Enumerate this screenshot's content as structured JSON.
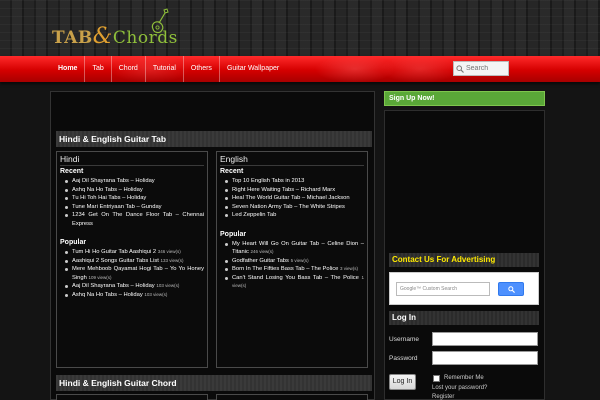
{
  "header": {
    "logo_tab": "TAB",
    "logo_amp": "&",
    "logo_chords": "Chords"
  },
  "nav": {
    "items": [
      "Home",
      "Tab",
      "Chord",
      "Tutorial",
      "Others",
      "Guitar Wallpaper"
    ],
    "search_placeholder": "Search"
  },
  "main": {
    "section1_title": "Hindi & English Guitar Tab",
    "section2_title": "Hindi & English Guitar Chord",
    "hindi": {
      "title": "Hindi",
      "recent_label": "Recent",
      "recent": [
        "Aaj Dil Shayrana Tabs – Holiday",
        "Ashq Na Ho Tabs – Holiday",
        "Tu Hi Toh Hai Tabs – Holiday",
        "Tune Mari Entriyaan Tab – Gunday",
        "1234 Get On The Dance Floor Tab – Chennai Express"
      ],
      "popular_label": "Popular",
      "popular": [
        {
          "text": "Tum Hi Ho Guitar Tab Aashiqui 2",
          "views": "346 view(s)"
        },
        {
          "text": "Aashiqui 2 Songs Guitar Tabs List",
          "views": "133 view(s)"
        },
        {
          "text": "Mere Mehboob Qayamat Hogi Tab – Yo Yo Honey Singh",
          "views": "109 view(s)"
        },
        {
          "text": "Aaj Dil Shayrana Tabs – Holiday",
          "views": "103 view(s)"
        },
        {
          "text": "Ashq Na Ho Tabs – Holiday",
          "views": "103 view(s)"
        }
      ]
    },
    "english": {
      "title": "English",
      "recent_label": "Recent",
      "recent": [
        "Top 10 English Tabs in 2013",
        "Right Here Waiting Tabs – Richard Marx",
        "Heal The World Guitar Tab – Michael Jackson",
        "Seven Nation Army Tab – The White Stripes",
        "Led Zeppelin Tab"
      ],
      "popular_label": "Popular",
      "popular": [
        {
          "text": "My Heart Will Go On Guitar Tab – Celine Dion – Titanic",
          "views": "246 view(s)"
        },
        {
          "text": "Godfather Guitar Tabs",
          "views": "5 view(s)"
        },
        {
          "text": "Born In The Fifties Bass Tab – The Police",
          "views": "3 view(s)"
        },
        {
          "text": "Can't Stand Losing You Bass Tab – The Police",
          "views": "1 view(s)"
        }
      ]
    }
  },
  "sidebar": {
    "signup": "Sign Up Now!",
    "ad_title": "Contact Us For Advertising",
    "gsearch_placeholder": "Google™ Custom Search",
    "login_title": "Log In",
    "username_label": "Username",
    "password_label": "Password",
    "login_button": "Log In",
    "remember_label": "Remember Me",
    "lost_password": "Lost your password?",
    "register": "Register"
  }
}
